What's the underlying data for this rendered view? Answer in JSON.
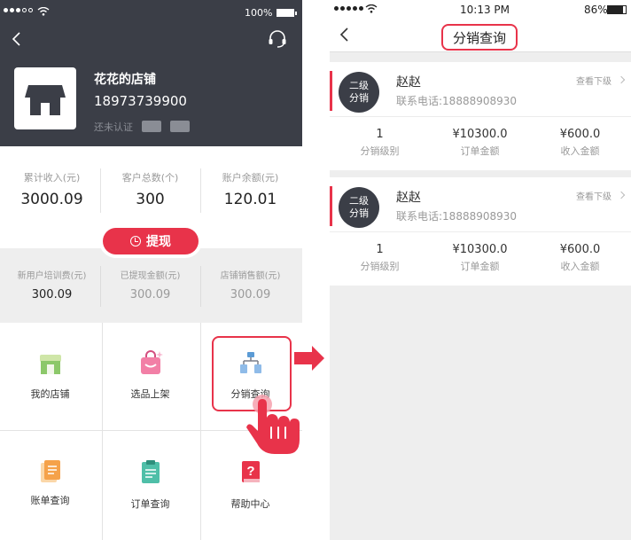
{
  "left": {
    "status": {
      "battery": "100%"
    },
    "store": {
      "name": "花花的店铺",
      "phone": "18973739900",
      "verify": "还未认证"
    },
    "stats": [
      {
        "label": "累计收入(元)",
        "value": "3000.09"
      },
      {
        "label": "客户总数(个)",
        "value": "300"
      },
      {
        "label": "账户余额(元)",
        "value": "120.01"
      }
    ],
    "withdraw_label": "提现",
    "gray_stats": [
      {
        "label": "新用户培训费(元)",
        "value": "300.09"
      },
      {
        "label": "已提现金额(元)",
        "value": "300.09"
      },
      {
        "label": "店铺销售额(元)",
        "value": "300.09"
      }
    ],
    "grid": [
      {
        "label": "我的店铺",
        "icon": "store-icon"
      },
      {
        "label": "选品上架",
        "icon": "shopping-bag-icon"
      },
      {
        "label": "分销查询",
        "icon": "org-chart-icon"
      },
      {
        "label": "账单查询",
        "icon": "bill-icon"
      },
      {
        "label": "订单查询",
        "icon": "clipboard-icon"
      },
      {
        "label": "帮助中心",
        "icon": "help-book-icon"
      }
    ]
  },
  "right": {
    "status": {
      "time": "10:13 PM",
      "battery": "86%"
    },
    "title": "分销查询",
    "cards": [
      {
        "badge_line1": "二级",
        "badge_line2": "分销",
        "name": "赵赵",
        "phone": "联系电话:18888908930",
        "view_sub": "查看下级",
        "level_value": "1",
        "level_label": "分销级别",
        "order_value": "¥10300.0",
        "order_label": "订单金额",
        "income_value": "¥600.0",
        "income_label": "收入金额"
      },
      {
        "badge_line1": "二级",
        "badge_line2": "分销",
        "name": "赵赵",
        "phone": "联系电话:18888908930",
        "view_sub": "查看下级",
        "level_value": "1",
        "level_label": "分销级别",
        "order_value": "¥10300.0",
        "order_label": "订单金额",
        "income_value": "¥600.0",
        "income_label": "收入金额"
      }
    ]
  },
  "colors": {
    "accent": "#e8334a",
    "header_dark": "#3b3e47",
    "band_gray": "#eeeeee"
  }
}
